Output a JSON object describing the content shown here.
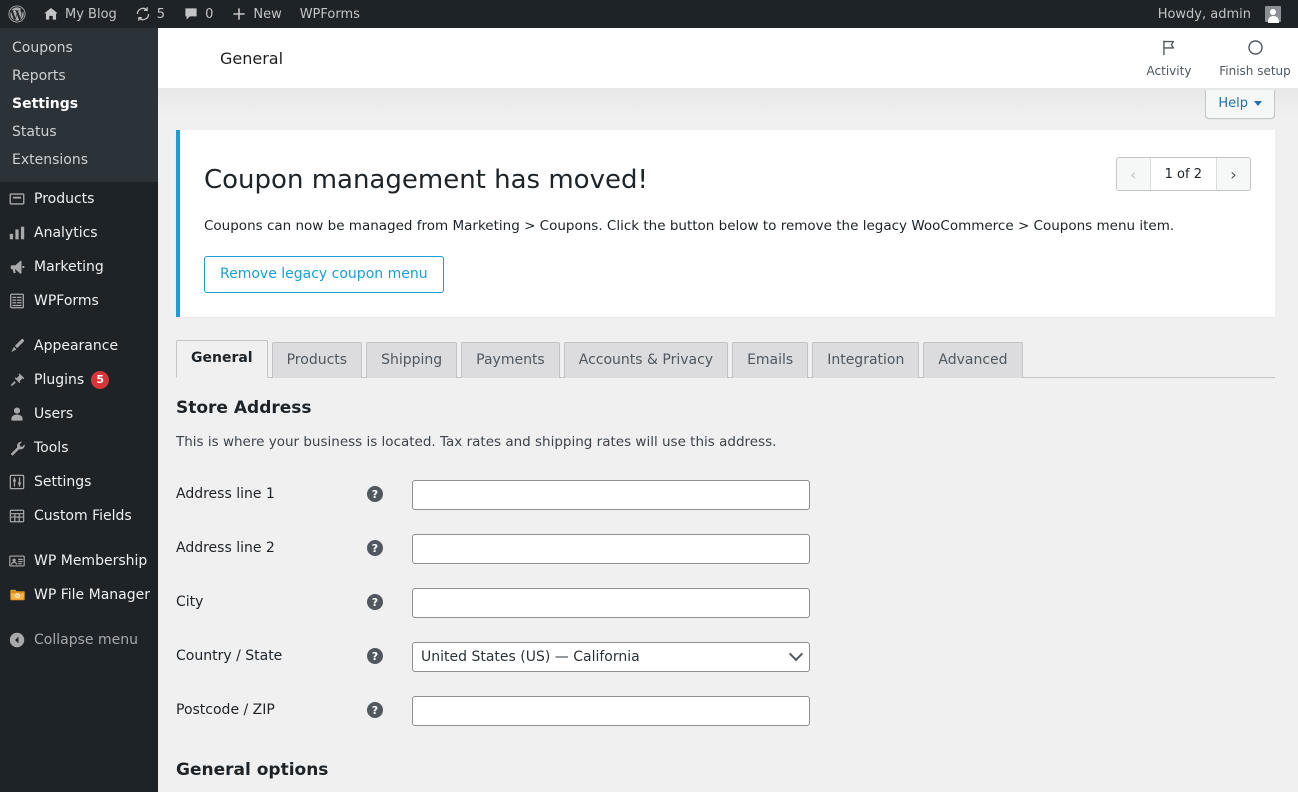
{
  "adminbar": {
    "logo_icon": "wordpress-logo-icon",
    "site_name": "My Blog",
    "home_icon": "home-icon",
    "updates_icon": "updates-icon",
    "updates_count": "5",
    "comments_icon": "comment-icon",
    "comments_count": "0",
    "new_icon": "plus-icon",
    "new_label": "New",
    "wpforms_label": "WPForms",
    "howdy": "Howdy, admin",
    "avatar_icon": "user-avatar"
  },
  "sidebar": {
    "submenu": [
      {
        "label": "Coupons",
        "current": false
      },
      {
        "label": "Reports",
        "current": false
      },
      {
        "label": "Settings",
        "current": true
      },
      {
        "label": "Status",
        "current": false
      },
      {
        "label": "Extensions",
        "current": false
      }
    ],
    "items": [
      {
        "label": "Products",
        "icon": "products-icon",
        "badge": ""
      },
      {
        "label": "Analytics",
        "icon": "analytics-icon",
        "badge": ""
      },
      {
        "label": "Marketing",
        "icon": "marketing-megaphone-icon",
        "badge": ""
      },
      {
        "label": "WPForms",
        "icon": "wpforms-icon",
        "badge": ""
      },
      {
        "label": "Appearance",
        "icon": "appearance-brush-icon",
        "badge": ""
      },
      {
        "label": "Plugins",
        "icon": "plugins-plug-icon",
        "badge": "5"
      },
      {
        "label": "Users",
        "icon": "users-icon",
        "badge": ""
      },
      {
        "label": "Tools",
        "icon": "tools-wrench-icon",
        "badge": ""
      },
      {
        "label": "Settings",
        "icon": "settings-sliders-icon",
        "badge": ""
      },
      {
        "label": "Custom Fields",
        "icon": "custom-fields-grid-icon",
        "badge": ""
      },
      {
        "label": "WP Membership",
        "icon": "wp-membership-card-icon",
        "badge": ""
      },
      {
        "label": "WP File Manager",
        "icon": "wp-file-manager-folder-icon",
        "badge": ""
      }
    ],
    "collapse_label": "Collapse menu",
    "collapse_icon": "collapse-arrow-icon"
  },
  "wc_header": {
    "title": "General",
    "activity_label": "Activity",
    "activity_icon": "flag-icon",
    "finish_setup_label": "Finish setup",
    "finish_setup_icon": "circle-progress-icon"
  },
  "help": {
    "label": "Help",
    "caret_icon": "chevron-down-icon"
  },
  "notice": {
    "heading": "Coupon management has moved!",
    "body": "Coupons can now be managed from Marketing > Coupons. Click the button below to remove the legacy WooCommerce > Coupons menu item.",
    "button_label": "Remove legacy coupon menu",
    "accent_color": "#1a9ed4",
    "pager": {
      "prev_icon": "chevron-left-icon",
      "next_icon": "chevron-right-icon",
      "label": "1 of 2"
    }
  },
  "tabs": [
    {
      "label": "General",
      "active": true
    },
    {
      "label": "Products",
      "active": false
    },
    {
      "label": "Shipping",
      "active": false
    },
    {
      "label": "Payments",
      "active": false
    },
    {
      "label": "Accounts & Privacy",
      "active": false
    },
    {
      "label": "Emails",
      "active": false
    },
    {
      "label": "Integration",
      "active": false
    },
    {
      "label": "Advanced",
      "active": false
    }
  ],
  "store_address": {
    "title": "Store Address",
    "description": "This is where your business is located. Tax rates and shipping rates will use this address.",
    "fields": [
      {
        "label": "Address line 1",
        "type": "text",
        "value": "",
        "placeholder": "",
        "help_icon": "help-tip-icon"
      },
      {
        "label": "Address line 2",
        "type": "text",
        "value": "",
        "placeholder": "",
        "help_icon": "help-tip-icon"
      },
      {
        "label": "City",
        "type": "text",
        "value": "",
        "placeholder": "",
        "help_icon": "help-tip-icon"
      },
      {
        "label": "Country / State",
        "type": "select",
        "value": "United States (US) — California",
        "placeholder": "",
        "help_icon": "help-tip-icon"
      },
      {
        "label": "Postcode / ZIP",
        "type": "text",
        "value": "",
        "placeholder": "",
        "help_icon": "help-tip-icon"
      }
    ]
  },
  "general_options": {
    "title": "General options"
  }
}
